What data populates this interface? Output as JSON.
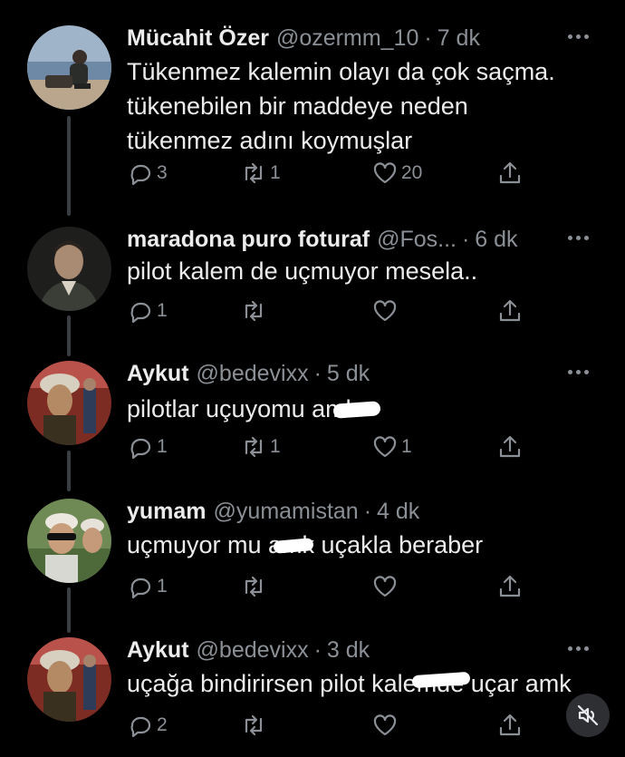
{
  "tweets": [
    {
      "name": "Mücahit Özer",
      "handle": "@ozermm_10",
      "time": "7 dk",
      "lines": [
        "Tükenmez kalemin olayı da çok saçma.",
        "tükenebilen bir maddeye neden",
        "tükenmez adını koymuşlar"
      ],
      "replies": "3",
      "retweets": "1",
      "likes": "20"
    },
    {
      "name": "maradona puro foturaf",
      "handle": "@Fos...",
      "time": "6 dk",
      "lines": [
        "pilot kalem de uçmuyor mesela.."
      ],
      "replies": "1",
      "retweets": "",
      "likes": ""
    },
    {
      "name": "Aykut",
      "handle": "@bedevixx",
      "time": "5 dk",
      "lines": [
        "pilotlar uçuyomu amk"
      ],
      "replies": "1",
      "retweets": "1",
      "likes": "1"
    },
    {
      "name": "yumam",
      "handle": "@yumamistan",
      "time": "4 dk",
      "lines": [
        "uçmuyor mu amk uçakla beraber"
      ],
      "replies": "1",
      "retweets": "",
      "likes": ""
    },
    {
      "name": "Aykut",
      "handle": "@bedevixx",
      "time": "3 dk",
      "lines": [
        "uçağa bindirirsen pilot kalemde uçar amk"
      ],
      "replies": "2",
      "retweets": "",
      "likes": ""
    }
  ],
  "separator": "·",
  "icons": {
    "reply": "reply-icon",
    "retweet": "retweet-icon",
    "like": "heart-icon",
    "share": "share-icon",
    "more": "more-icon",
    "mute": "mute-icon"
  },
  "colors": {
    "background": "#000000",
    "text": "#e7e9ea",
    "secondary": "#8b9096",
    "thread_line": "#3a3d42"
  }
}
